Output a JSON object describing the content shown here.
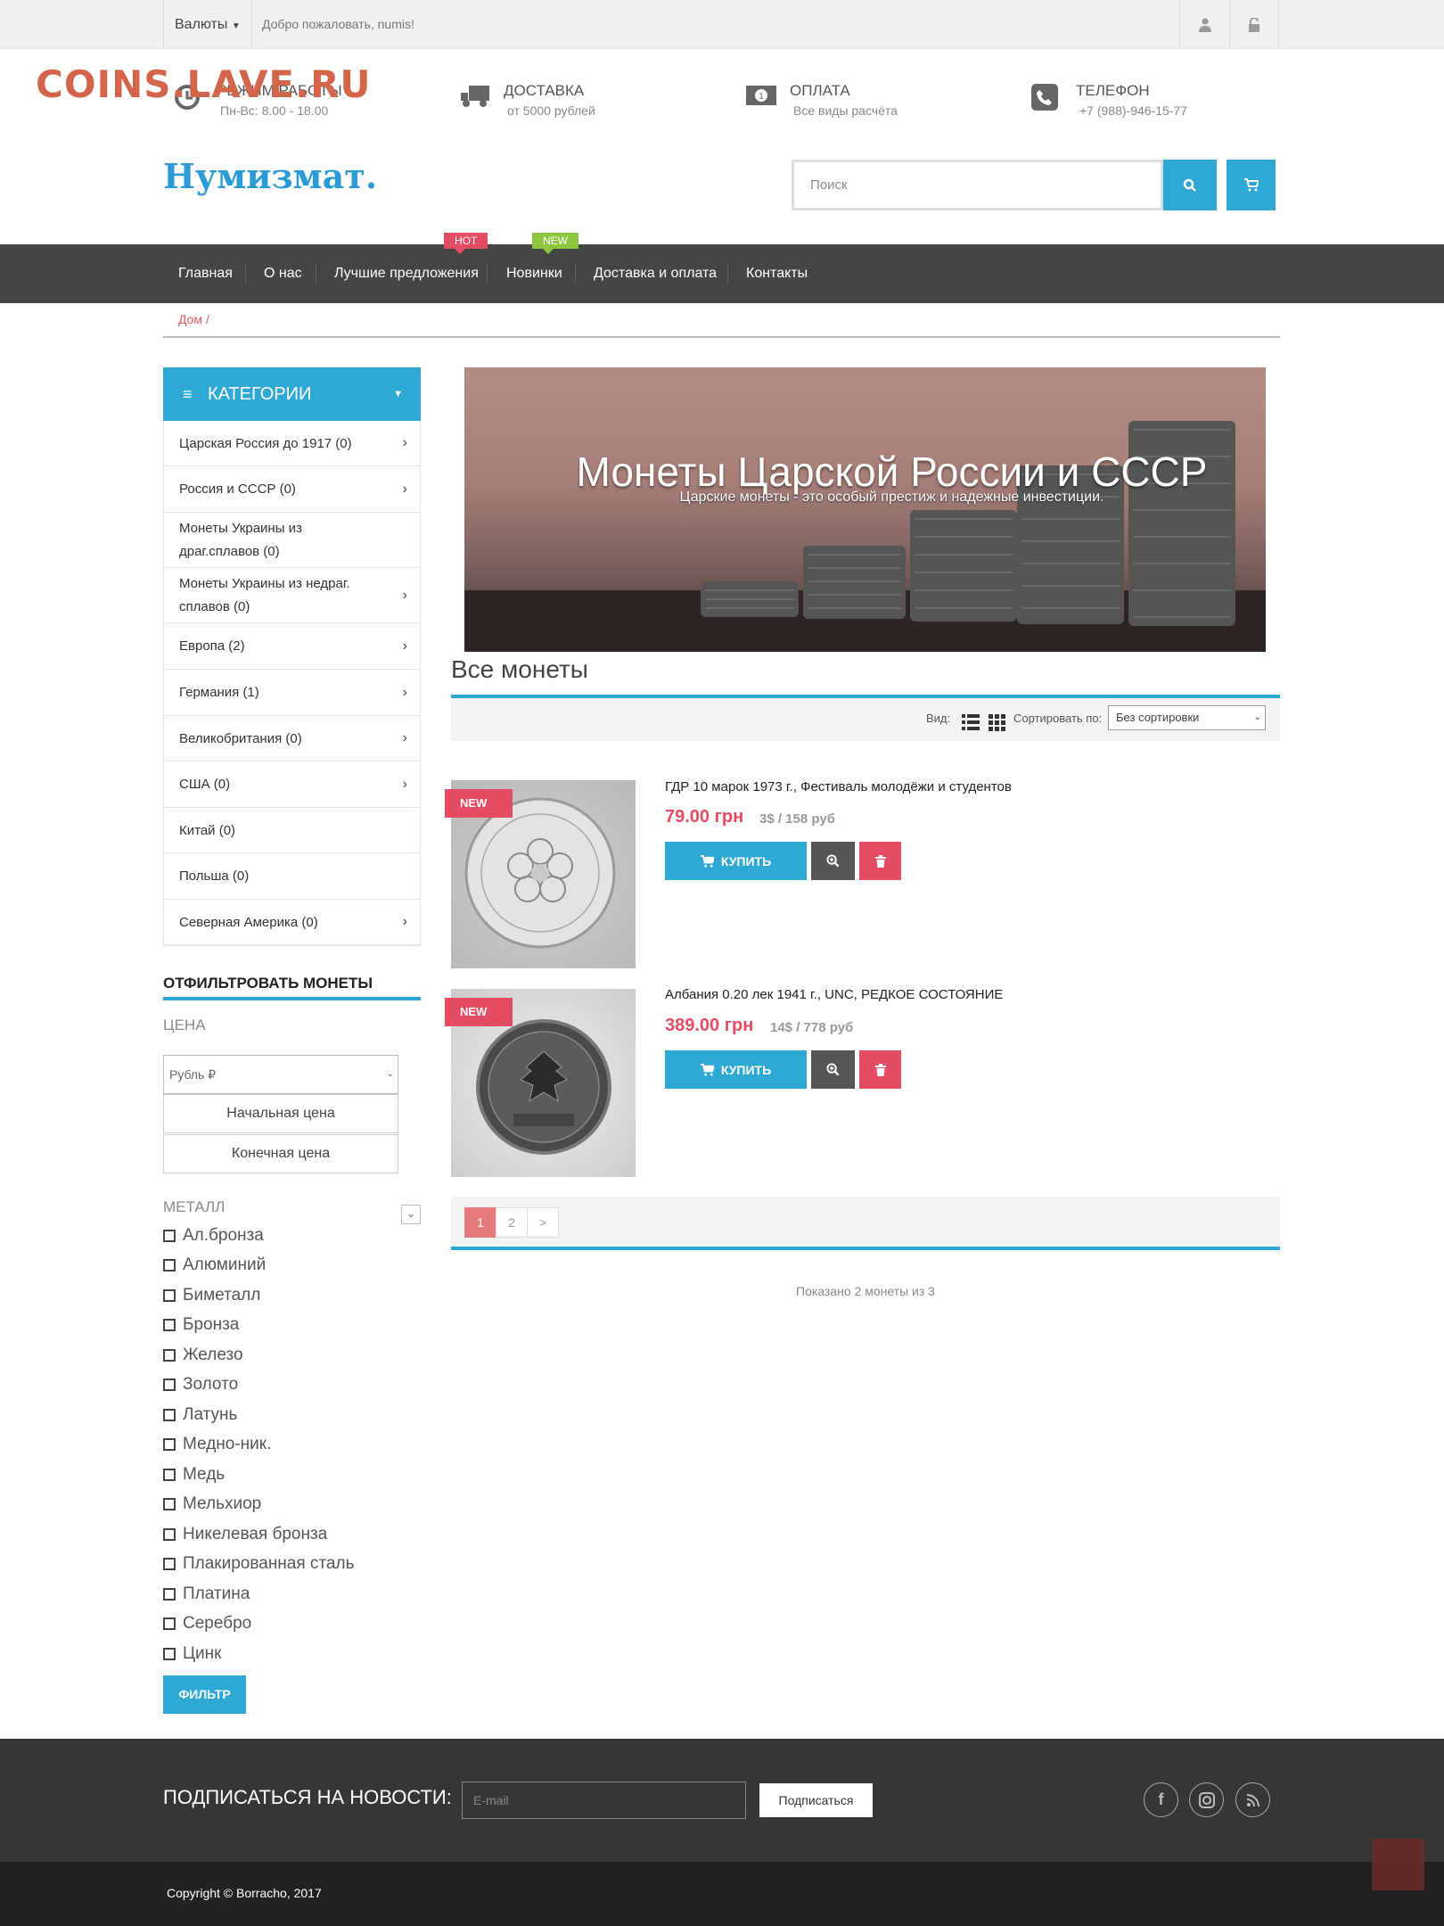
{
  "watermark": "COINS.LAVE.RU",
  "topbar": {
    "currency": "Валюты",
    "welcome": "Добро пожаловать, numis!"
  },
  "info": [
    {
      "title": "РЕЖИМ РАБОТЫ",
      "sub": "Пн-Вс: 8.00 - 18.00",
      "icon": "clock-icon"
    },
    {
      "title": "ДОСТАВКА",
      "sub": "от 5000 рублей",
      "icon": "truck-icon"
    },
    {
      "title": "ОПЛАТА",
      "sub": "Все виды расчёта",
      "icon": "money-icon"
    },
    {
      "title": "ТЕЛЕФОН",
      "sub": "+7 (988)-946-15-77",
      "icon": "phone-icon"
    }
  ],
  "logo": "Нумизмат.",
  "search": {
    "placeholder": "Поиск"
  },
  "nav": {
    "items": [
      "Главная",
      "О нас",
      "Лучшие предложения",
      "Новинки",
      "Доставка и оплата",
      "Контакты"
    ],
    "hot": "HOT",
    "new": "NEW"
  },
  "breadcrumb": "Дом /",
  "categories": {
    "title": "КАТЕГОРИИ",
    "items": [
      "Царская Россия до 1917 (0)",
      "Россия и СССР (0)",
      "Монеты Украины из драг.сплавов (0)",
      "Монеты Украины из недраг. сплавов (0)",
      "Европа (2)",
      "Германия (1)",
      "Великобритания (0)",
      "США (0)",
      "Китай (0)",
      "Польша (0)",
      "Северная Америка (0)"
    ]
  },
  "filter": {
    "title": "ОТФИЛЬТРОВАТЬ МОНЕТЫ",
    "price_label": "ЦЕНА",
    "currency_select": "Рубль ₽",
    "start_price": "Начальная цена",
    "end_price": "Конечная цена",
    "metal_label": "МЕТАЛЛ",
    "metals": [
      "Ал.бронза",
      "Алюминий",
      "Биметалл",
      "Бронза",
      "Железо",
      "Золото",
      "Латунь",
      "Медно-ник.",
      "Медь",
      "Мельхиор",
      "Никелевая бронза",
      "Плакированная сталь",
      "Платина",
      "Серебро",
      "Цинк"
    ],
    "button": "ФИЛЬТР"
  },
  "banner": {
    "title": "Монеты Царской России и СССР",
    "subtitle": "Царские монеты - это особый престиж и надежные инвестиции."
  },
  "heading": "Все монеты",
  "toolbar": {
    "view": "Вид:",
    "sort_label": "Сортировать по:",
    "sort_value": "Без сортировки"
  },
  "products": [
    {
      "badge": "NEW",
      "name": "ГДР 10 марок 1973 г., Фестиваль молодёжи и студентов",
      "price": "79.00 грн",
      "alt_price": "3$ / 158 руб",
      "buy": "КУПИТЬ"
    },
    {
      "badge": "NEW",
      "name": "Албания 0.20 лек 1941 г., UNC, РЕДКОЕ СОСТОЯНИЕ",
      "price": "389.00 грн",
      "alt_price": "14$ / 778 руб",
      "buy": "КУПИТЬ"
    }
  ],
  "pagination": [
    "1",
    "2",
    ">"
  ],
  "shown": "Показано 2 монеты из 3",
  "footer": {
    "subscribe": "ПОДПИСАТЬСЯ НА НОВОСТИ:",
    "email_placeholder": "E-mail",
    "subscribe_btn": "Подписаться",
    "copyright": "Copyright © Borracho, 2017"
  },
  "colors": {
    "accent": "#2da9d4",
    "sale": "#e34c62",
    "nav": "#454545",
    "hot": "#e34c62",
    "new": "#8dc63f"
  }
}
